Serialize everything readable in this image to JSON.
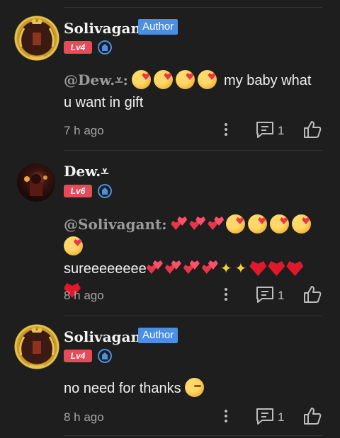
{
  "comments": [
    {
      "name": "Solivagant",
      "author_label": "Author",
      "level": "Lv4",
      "mention": "@Dew.⩡:",
      "text_line": "my baby what",
      "text_line2": "u want in gift",
      "time": "7 h ago",
      "reply_count": "1"
    },
    {
      "name": "Dew.⩡",
      "level": "Lv6",
      "mention": "@Solivagant:",
      "text_main": "sureeeeeeee",
      "time": "8 h ago",
      "reply_count": "1"
    },
    {
      "name": "Solivagant",
      "author_label": "Author",
      "level": "Lv4",
      "text": "no need for thanks",
      "time": "8 h ago",
      "reply_count": "1"
    }
  ],
  "icons": {
    "more": "more-vertical-icon",
    "reply": "comment-icon",
    "like": "thumbs-up-icon",
    "verified": "verified-shield-icon"
  },
  "colors": {
    "author_badge": "#4a8fe0",
    "level_badge": "#e64b5a",
    "background": "#1e1e1e"
  }
}
